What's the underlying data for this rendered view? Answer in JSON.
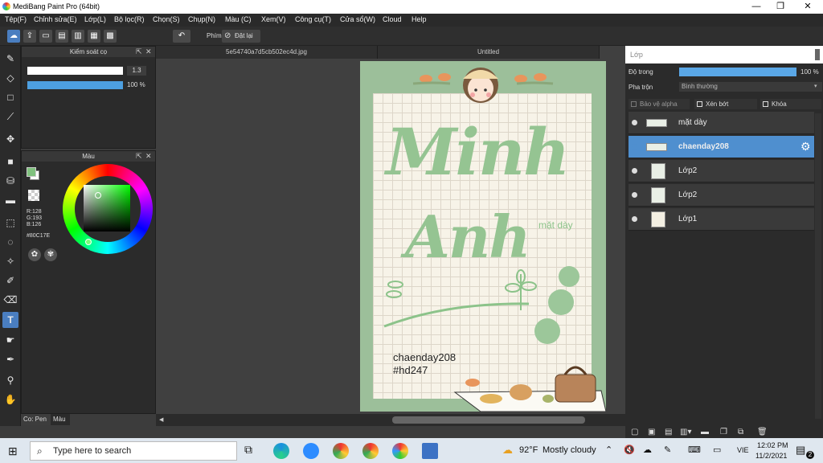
{
  "window": {
    "title": "MediBang Paint Pro (64bit)"
  },
  "menu": [
    "Tệp(F)",
    "Chỉnh sửa(E)",
    "Lớp(L)",
    "Bộ lọc(R)",
    "Chọn(S)",
    "Chụp(N)",
    "Màu (C)",
    "Xem(V)",
    "Công cụ(T)",
    "Cửa sổ(W)",
    "Cloud",
    "Help"
  ],
  "toolbar": {
    "key_label": "Phím",
    "reset_label": "Đặt lại"
  },
  "brush_panel": {
    "title": "Kiểm soát cọ",
    "size": "1.3",
    "opacity": "100 %"
  },
  "color_panel": {
    "title": "Màu",
    "r": "R:128",
    "g": "G:193",
    "b": "B:126",
    "hex": "#80C17E",
    "current_color": "#80c17e"
  },
  "bottom_tabs": {
    "pen": "Co: Pen",
    "color": "Màu"
  },
  "docs": {
    "tab1": "5e54740a7d5cb502ec4d.jpg",
    "tab2": "Untitled"
  },
  "artwork": {
    "title1": "Minh",
    "title2": "Anh",
    "subtitle": "mặt dày",
    "author": "chaenday208",
    "tag": "#hd247"
  },
  "layers": {
    "title": "Lớp",
    "opacity_label": "Độ trong",
    "opacity_value": "100 %",
    "opacity_fraction": 1.0,
    "blend_label": "Pha trộn",
    "blend_value": "Bình thường",
    "alpha_label": "Bảo vệ alpha",
    "clip_label": "Xén bớt",
    "lock_label": "Khóa",
    "items": [
      {
        "name": "mặt dày"
      },
      {
        "name": "chaenday208"
      },
      {
        "name": "Lớp2"
      },
      {
        "name": "Lớp2"
      },
      {
        "name": "Lớp1"
      }
    ]
  },
  "taskbar": {
    "search": "Type here to search",
    "weather_temp": "92°F",
    "weather_text": "Mostly cloudy",
    "lang": "VIE",
    "time": "12:02 PM",
    "date": "11/2/2021",
    "notif": "2"
  }
}
